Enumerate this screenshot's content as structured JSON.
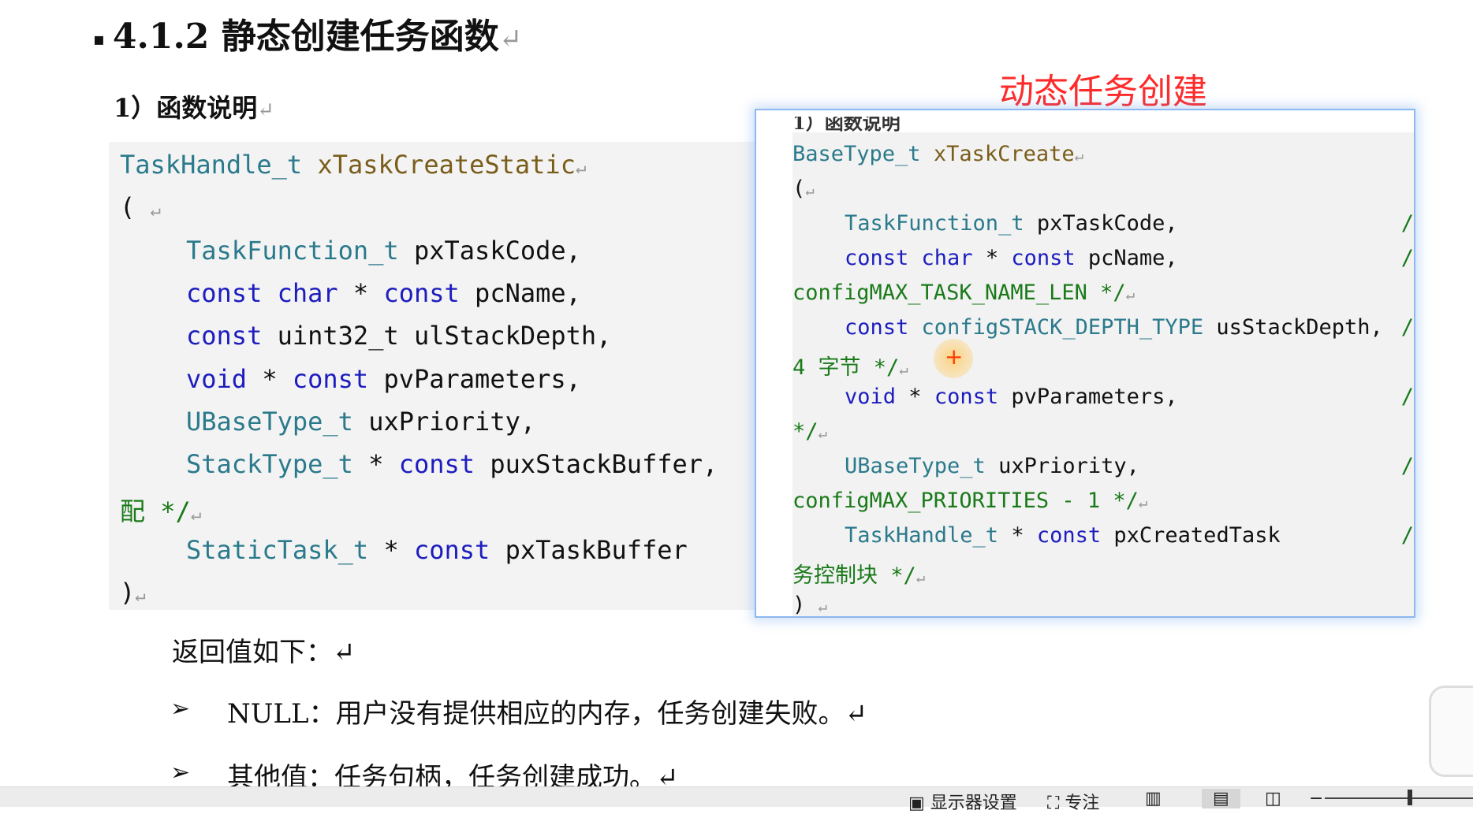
{
  "heading": {
    "bullet": "▪",
    "text": "4.1.2 静态创建任务函数",
    "mark": "↵"
  },
  "subheading": {
    "text": "1）函数说明",
    "mark": "↵"
  },
  "static_code": [
    {
      "indent": 0,
      "parts": [
        {
          "cls": "t",
          "v": "TaskHandle_t"
        },
        {
          "cls": "p",
          "v": " "
        },
        {
          "cls": "f",
          "v": "xTaskCreateStatic"
        },
        {
          "cls": "arrow",
          "v": "↵"
        }
      ]
    },
    {
      "indent": 0,
      "parts": [
        {
          "cls": "p",
          "v": "( "
        },
        {
          "cls": "arrow",
          "v": "↵"
        }
      ]
    },
    {
      "indent": 1,
      "parts": [
        {
          "cls": "t",
          "v": "TaskFunction_t"
        },
        {
          "cls": "p",
          "v": " pxTaskCode,"
        }
      ]
    },
    {
      "indent": 1,
      "parts": [
        {
          "cls": "k",
          "v": "const"
        },
        {
          "cls": "p",
          "v": " "
        },
        {
          "cls": "k",
          "v": "char"
        },
        {
          "cls": "p",
          "v": " * "
        },
        {
          "cls": "k",
          "v": "const"
        },
        {
          "cls": "p",
          "v": " pcName,"
        }
      ]
    },
    {
      "indent": 1,
      "parts": [
        {
          "cls": "k",
          "v": "const"
        },
        {
          "cls": "p",
          "v": " uint32_t ulStackDepth,"
        }
      ]
    },
    {
      "indent": 1,
      "parts": [
        {
          "cls": "k",
          "v": "void"
        },
        {
          "cls": "p",
          "v": " * "
        },
        {
          "cls": "k",
          "v": "const"
        },
        {
          "cls": "p",
          "v": " pvParameters,"
        }
      ]
    },
    {
      "indent": 1,
      "parts": [
        {
          "cls": "t",
          "v": "UBaseType_t"
        },
        {
          "cls": "p",
          "v": " uxPriority,"
        }
      ]
    },
    {
      "indent": 1,
      "parts": [
        {
          "cls": "t",
          "v": "StackType_t"
        },
        {
          "cls": "p",
          "v": " * "
        },
        {
          "cls": "k",
          "v": "const"
        },
        {
          "cls": "p",
          "v": " puxStackBuffer,"
        }
      ]
    },
    {
      "indent": 0,
      "parts": [
        {
          "cls": "c",
          "v": "配 */"
        },
        {
          "cls": "arrow",
          "v": "↵"
        }
      ]
    },
    {
      "indent": 1,
      "parts": [
        {
          "cls": "t",
          "v": "StaticTask_t"
        },
        {
          "cls": "p",
          "v": " * "
        },
        {
          "cls": "k",
          "v": "const"
        },
        {
          "cls": "p",
          "v": " pxTaskBuffer"
        }
      ]
    },
    {
      "indent": 0,
      "parts": [
        {
          "cls": "p",
          "v": ")"
        },
        {
          "cls": "arrow",
          "v": "↵"
        }
      ]
    }
  ],
  "dynamic_label": "动态任务创建",
  "dynamic_cut_title": "1）函数说明",
  "dynamic_code": [
    {
      "indent": 0,
      "slash": false,
      "parts": [
        {
          "cls": "t",
          "v": "BaseType_t"
        },
        {
          "cls": "p",
          "v": " "
        },
        {
          "cls": "f",
          "v": "xTaskCreate"
        },
        {
          "cls": "arrow",
          "v": "↵"
        }
      ]
    },
    {
      "indent": 0,
      "slash": false,
      "parts": [
        {
          "cls": "p",
          "v": "("
        },
        {
          "cls": "arrow",
          "v": "↵"
        }
      ]
    },
    {
      "indent": 1,
      "slash": true,
      "parts": [
        {
          "cls": "t",
          "v": "TaskFunction_t"
        },
        {
          "cls": "p",
          "v": " pxTaskCode,"
        }
      ]
    },
    {
      "indent": 1,
      "slash": true,
      "parts": [
        {
          "cls": "k",
          "v": "const"
        },
        {
          "cls": "p",
          "v": " "
        },
        {
          "cls": "k",
          "v": "char"
        },
        {
          "cls": "p",
          "v": " * "
        },
        {
          "cls": "k",
          "v": "const"
        },
        {
          "cls": "p",
          "v": " pcName,"
        }
      ]
    },
    {
      "indent": 0,
      "slash": false,
      "parts": [
        {
          "cls": "c",
          "v": "configMAX_TASK_NAME_LEN */"
        },
        {
          "cls": "arrow",
          "v": "↵"
        }
      ]
    },
    {
      "indent": 1,
      "slash": true,
      "parts": [
        {
          "cls": "k",
          "v": "const"
        },
        {
          "cls": "p",
          "v": " "
        },
        {
          "cls": "t",
          "v": "configSTACK_DEPTH_TYPE"
        },
        {
          "cls": "p",
          "v": " usStackDepth,"
        }
      ]
    },
    {
      "indent": 0,
      "slash": false,
      "parts": [
        {
          "cls": "c",
          "v": "4 字节 */"
        },
        {
          "cls": "arrow",
          "v": "↵"
        }
      ]
    },
    {
      "indent": 1,
      "slash": true,
      "parts": [
        {
          "cls": "k",
          "v": "void"
        },
        {
          "cls": "p",
          "v": " * "
        },
        {
          "cls": "k",
          "v": "const"
        },
        {
          "cls": "p",
          "v": " pvParameters,"
        }
      ]
    },
    {
      "indent": 0,
      "slash": false,
      "parts": [
        {
          "cls": "c",
          "v": "*/"
        },
        {
          "cls": "arrow",
          "v": "↵"
        }
      ]
    },
    {
      "indent": 1,
      "slash": true,
      "parts": [
        {
          "cls": "t",
          "v": "UBaseType_t"
        },
        {
          "cls": "p",
          "v": " uxPriority,"
        }
      ]
    },
    {
      "indent": 0,
      "slash": false,
      "parts": [
        {
          "cls": "c",
          "v": "configMAX_PRIORITIES - 1 */"
        },
        {
          "cls": "arrow",
          "v": "↵"
        }
      ]
    },
    {
      "indent": 1,
      "slash": true,
      "parts": [
        {
          "cls": "t",
          "v": "TaskHandle_t"
        },
        {
          "cls": "p",
          "v": " * "
        },
        {
          "cls": "k",
          "v": "const"
        },
        {
          "cls": "p",
          "v": " pxCreatedTask"
        }
      ]
    },
    {
      "indent": 0,
      "slash": false,
      "parts": [
        {
          "cls": "c",
          "v": "务控制块 */"
        },
        {
          "cls": "arrow",
          "v": "↵"
        }
      ]
    },
    {
      "indent": 0,
      "slash": false,
      "parts": [
        {
          "cls": "p",
          "v": ")  "
        },
        {
          "cls": "arrow",
          "v": "↵"
        }
      ]
    }
  ],
  "cursor_symbol": "+",
  "return_intro": "返回值如下：↵",
  "bullets": [
    {
      "marker": "➢",
      "text": "NULL：用户没有提供相应的内存，任务创建失败。↵"
    },
    {
      "marker": "➢",
      "text": "其他值：任务句柄，任务创建成功。↵"
    }
  ],
  "statusbar": {
    "display_settings": "显示器设置",
    "focus": "专注"
  }
}
